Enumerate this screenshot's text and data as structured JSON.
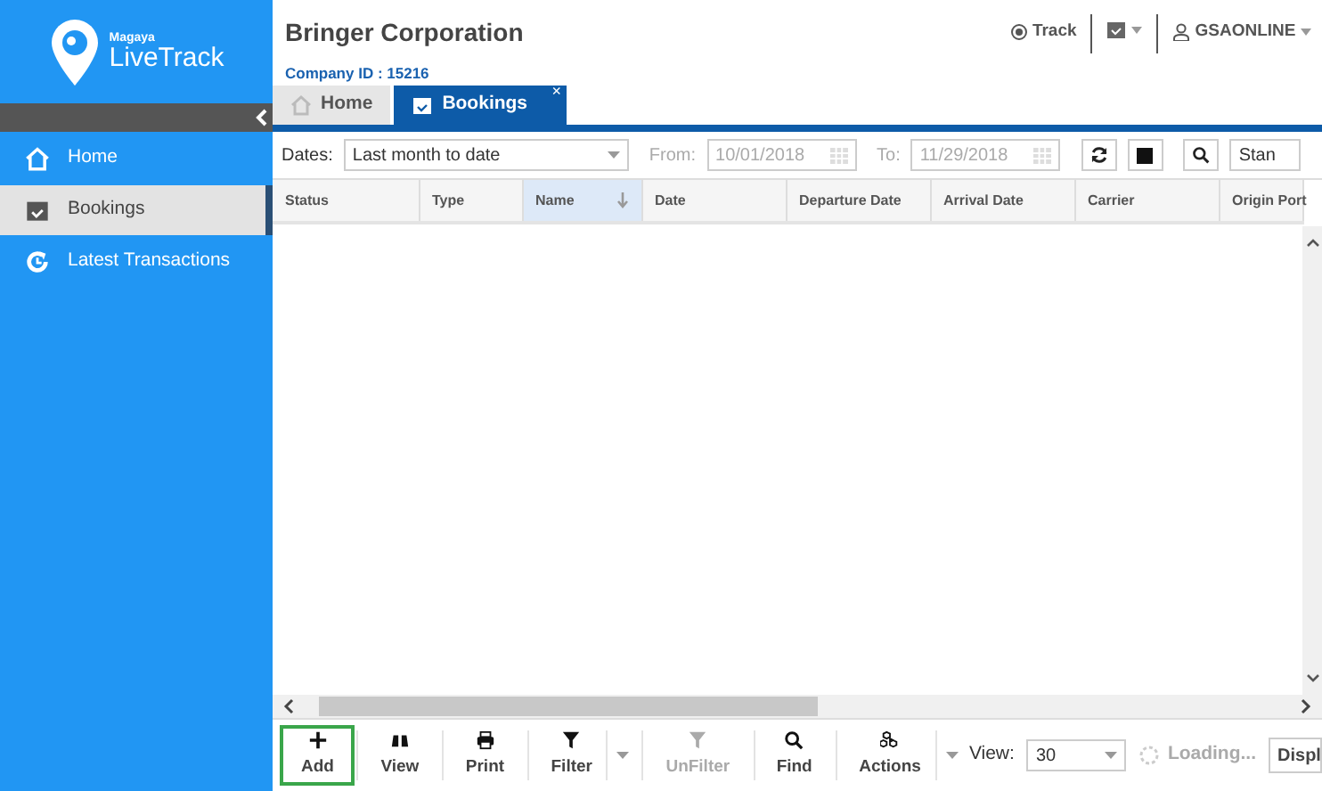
{
  "logo": {
    "brand": "Magaya",
    "product": "LiveTrack"
  },
  "sidebar": {
    "items": [
      {
        "label": "Home",
        "selected": false
      },
      {
        "label": "Bookings",
        "selected": true
      },
      {
        "label": "Latest Transactions",
        "selected": false
      }
    ]
  },
  "header": {
    "company": "Bringer Corporation",
    "company_id": "Company ID : 15216",
    "track": "Track",
    "user": "GSAONLINE"
  },
  "tabs": [
    {
      "label": "Home",
      "selected": false
    },
    {
      "label": "Bookings",
      "selected": true,
      "close": "×"
    }
  ],
  "filter": {
    "dates_label": "Dates:",
    "dates_value": "Last month to date",
    "from_label": "From:",
    "from_value": "10/01/2018",
    "to_label": "To:",
    "to_value": "11/29/2018",
    "layout_value": "Stan"
  },
  "table": {
    "columns": [
      {
        "label": "Status",
        "sorted": false
      },
      {
        "label": "Type",
        "sorted": false
      },
      {
        "label": "Name",
        "sorted": true
      },
      {
        "label": "Date",
        "sorted": false
      },
      {
        "label": "Departure Date",
        "sorted": false
      },
      {
        "label": "Arrival Date",
        "sorted": false
      },
      {
        "label": "Carrier",
        "sorted": false
      },
      {
        "label": "Origin Port",
        "sorted": false
      }
    ]
  },
  "actions": [
    {
      "label": "Add",
      "disabled": false,
      "focused": true,
      "dropdown": false
    },
    {
      "label": "View",
      "disabled": false,
      "focused": false,
      "dropdown": false
    },
    {
      "label": "Print",
      "disabled": false,
      "focused": false,
      "dropdown": false
    },
    {
      "label": "Filter",
      "disabled": false,
      "focused": false,
      "dropdown": true
    },
    {
      "label": "UnFilter",
      "disabled": true,
      "focused": false,
      "dropdown": false
    },
    {
      "label": "Find",
      "disabled": false,
      "focused": false,
      "dropdown": false
    },
    {
      "label": "Actions",
      "disabled": false,
      "focused": false,
      "dropdown": true
    }
  ],
  "footer": {
    "view_label": "View:",
    "view_value": "30",
    "loading": "Loading...",
    "display": "Displ"
  }
}
